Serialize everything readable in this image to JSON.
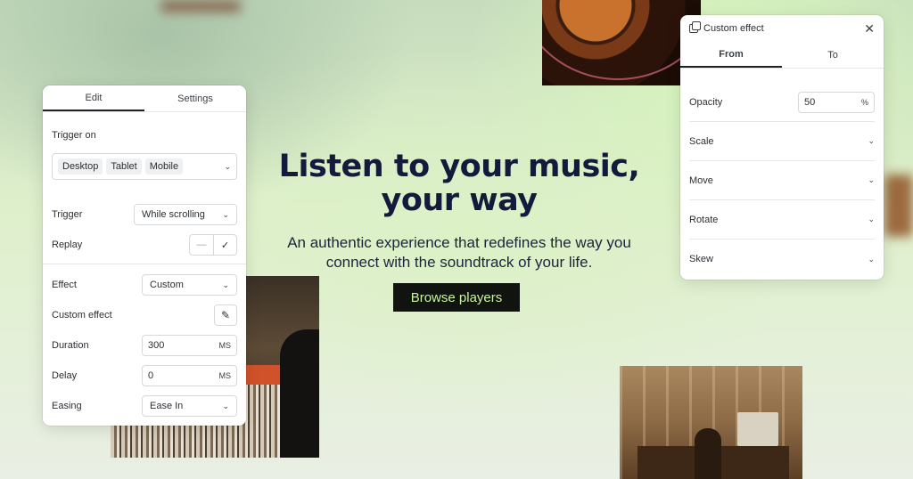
{
  "hero": {
    "title_line1": "Listen to your music,",
    "title_line2": "your way",
    "subtitle_line1": "An authentic experience that redefines the way you",
    "subtitle_line2": "connect with the soundtrack of your life.",
    "cta": "Browse players"
  },
  "edit_panel": {
    "tabs": [
      "Edit",
      "Settings"
    ],
    "active_tab": "Edit",
    "trigger_on_label": "Trigger on",
    "devices": [
      "Desktop",
      "Tablet",
      "Mobile"
    ],
    "trigger_label": "Trigger",
    "trigger_value": "While scrolling",
    "replay_label": "Replay",
    "replay_off": "—",
    "replay_on": "✓",
    "effect_label": "Effect",
    "effect_value": "Custom",
    "custom_effect_label": "Custom effect",
    "duration_label": "Duration",
    "duration_value": "300",
    "duration_unit": "MS",
    "delay_label": "Delay",
    "delay_value": "0",
    "delay_unit": "MS",
    "easing_label": "Easing",
    "easing_value": "Ease In"
  },
  "effect_panel": {
    "title": "Custom effect",
    "tabs": [
      "From",
      "To"
    ],
    "active_tab": "From",
    "opacity_label": "Opacity",
    "opacity_value": "50",
    "opacity_unit": "%",
    "sections": [
      "Scale",
      "Move",
      "Rotate",
      "Skew"
    ]
  },
  "colors": {
    "cta_bg": "#101310",
    "cta_text": "#c8f59e",
    "title": "#141a3c"
  },
  "icons": [
    "copy-icon",
    "close-icon",
    "chevron-down-icon",
    "pencil-icon",
    "check-icon"
  ]
}
